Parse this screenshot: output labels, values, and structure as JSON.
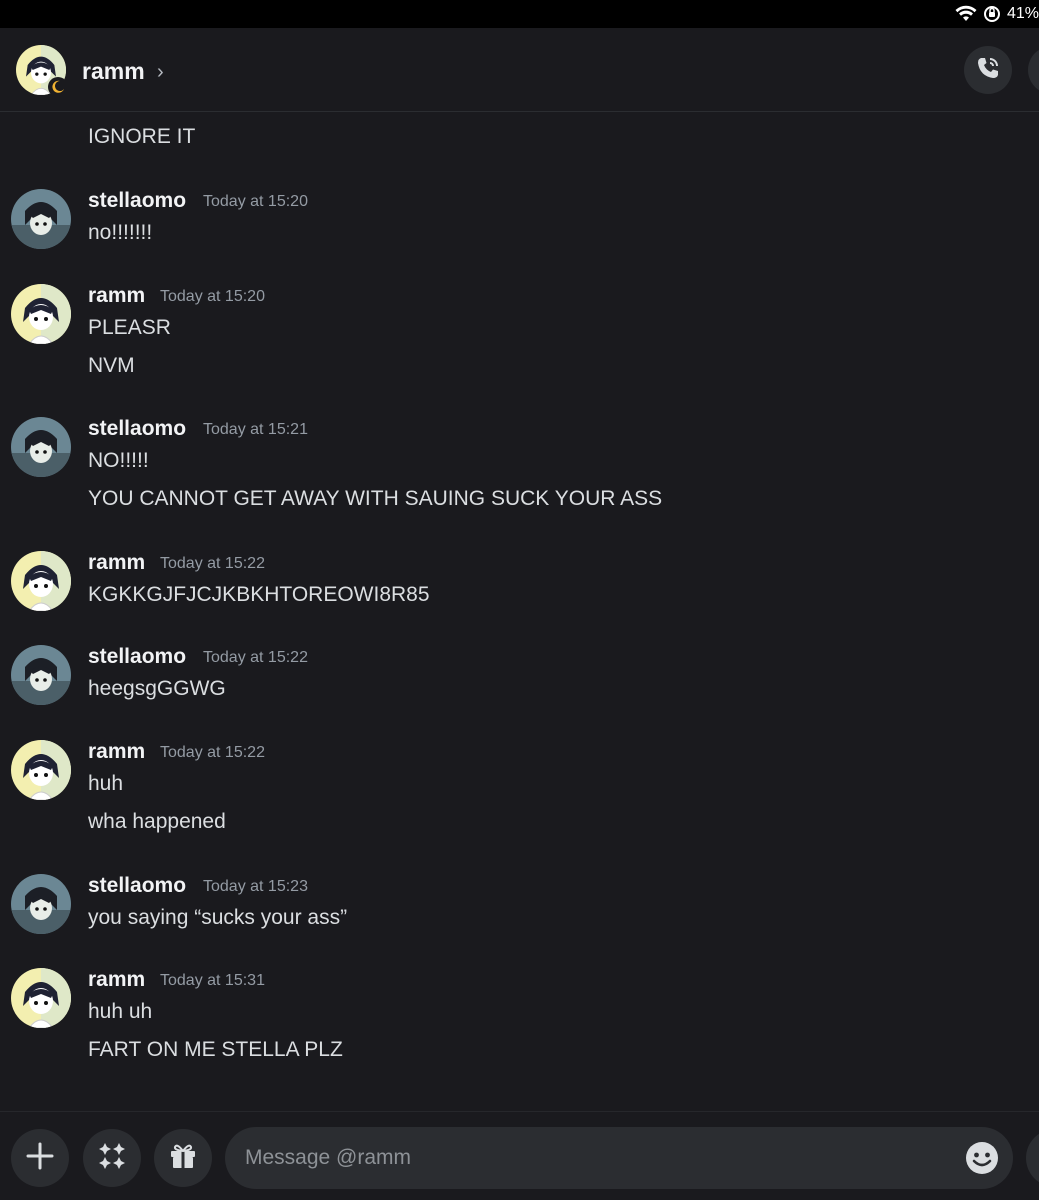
{
  "status_bar": {
    "battery": "41%"
  },
  "header": {
    "title": "ramm",
    "chevron": "›"
  },
  "messages": {
    "top_line": "IGNORE IT",
    "groups": [
      {
        "author": "stellaomo",
        "time": "Today at 15:20",
        "lines": [
          "no!!!!!!!"
        ]
      },
      {
        "author": "ramm",
        "time": "Today at 15:20",
        "lines": [
          "PLEASR",
          "NVM"
        ]
      },
      {
        "author": "stellaomo",
        "time": "Today at 15:21",
        "lines": [
          "NO!!!!!",
          "YOU CANNOT GET AWAY WITH SAUING SUCK YOUR ASS"
        ]
      },
      {
        "author": "ramm",
        "time": "Today at 15:22",
        "lines": [
          "KGKKGJFJCJKBKHTOREOWI8R85"
        ]
      },
      {
        "author": "stellaomo",
        "time": "Today at 15:22",
        "lines": [
          "heegsgGGWG"
        ]
      },
      {
        "author": "ramm",
        "time": "Today at 15:22",
        "lines": [
          "huh",
          "wha happened"
        ]
      },
      {
        "author": "stellaomo",
        "time": "Today at 15:23",
        "lines": [
          "you saying “sucks your ass”"
        ]
      },
      {
        "author": "ramm",
        "time": "Today at 15:31",
        "lines": [
          "huh uh",
          "FART ON ME STELLA PLZ"
        ]
      }
    ]
  },
  "composer": {
    "placeholder": "Message @ramm"
  },
  "icons": {
    "wifi": "wifi-icon",
    "orientation_lock": "orientation-lock-icon",
    "call": "phone-call-icon",
    "idle_status": "moon-icon",
    "add": "plus-icon",
    "apps": "apps-sparkle-icon",
    "gift": "gift-icon",
    "emoji": "emoji-icon"
  },
  "colors": {
    "background": "#1a1a1e",
    "surface": "#2b2d31",
    "text": "#dbdee1",
    "muted": "#949ba4",
    "idle": "#f0b232"
  }
}
